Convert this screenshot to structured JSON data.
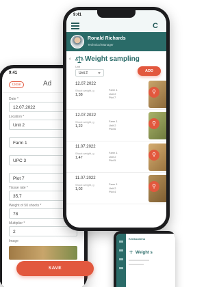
{
  "back_phone": {
    "status_time": "9:41",
    "close_label": "Close",
    "title": "Ad",
    "fields": [
      {
        "label": "Date *",
        "value": "12.07.2022",
        "select": false
      },
      {
        "label": "Location *",
        "value": "Unit 2",
        "select": true
      },
      {
        "label": "",
        "value": "Farm 1",
        "select": true
      },
      {
        "label": "",
        "value": "UPC 3",
        "select": true
      },
      {
        "label": "",
        "value": "Plot 7",
        "select": true
      },
      {
        "label": "Tissue rate *",
        "value": "35,7",
        "select": false
      },
      {
        "label": "Weight of 50 shoots *",
        "value": "78",
        "select": false
      },
      {
        "label": "Multiplier *",
        "value": "2",
        "select": false
      }
    ],
    "image_label": "Image",
    "save_label": "SAVE"
  },
  "front_phone": {
    "status_time": "9:41",
    "user": {
      "name": "Ronald Richards",
      "role": "Technical Manager"
    },
    "page_title": "Weight sampling",
    "unit_caption": "Unit",
    "unit_value": "Unit 2",
    "add_label": "ADD",
    "rows": [
      {
        "date": "12.07.2022",
        "weight_label": "Shoot weight, g",
        "weight": "1,38",
        "farm": "Farm 1",
        "unit": "Unit 2",
        "plot": "Plot 7"
      },
      {
        "date": "12.07.2022",
        "weight_label": "Shoot weight, g",
        "weight": "1,22",
        "farm": "Farm 1",
        "unit": "Unit 2",
        "plot": "Plot 6"
      },
      {
        "date": "11.07.2022",
        "weight_label": "Shoot weight, g",
        "weight": "1,47",
        "farm": "Farm 1",
        "unit": "Unit 2",
        "plot": "Plot 5"
      },
      {
        "date": "11.07.2022",
        "weight_label": "Shoot weight, g",
        "weight": "1,02",
        "farm": "Farm 1",
        "unit": "Unit 2",
        "plot": "Plot 4"
      }
    ],
    "thumb_colors": [
      "#b88a4e",
      "#8e9b55",
      "#c49a5c",
      "#a58248"
    ]
  },
  "tablet": {
    "brand": "Kenkoumino",
    "title": "Weight s"
  },
  "colors": {
    "primary": "#2a6b68",
    "accent": "#e2583e"
  }
}
